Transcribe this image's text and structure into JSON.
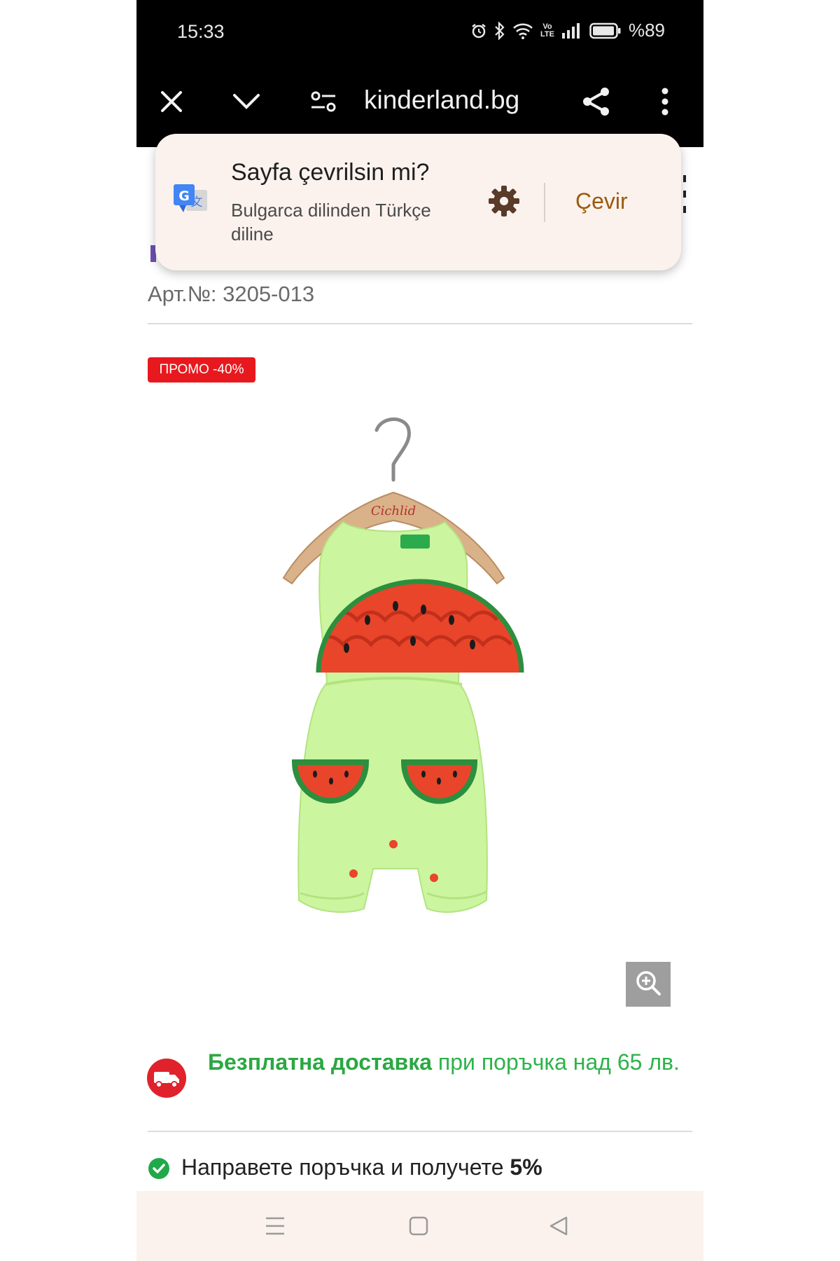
{
  "status_bar": {
    "time": "15:33",
    "battery": "%89"
  },
  "browser": {
    "url": "kinderland.bg",
    "icons": [
      "close-icon",
      "chevron-down-icon",
      "page-info-icon",
      "share-icon",
      "more-vert-icon"
    ]
  },
  "translate_popup": {
    "title": "Sayfa çevrilsin mi?",
    "subtitle": "Bulgarca dilinden Türkçe diline",
    "action_label": "Çevir",
    "icons": [
      "google-translate-icon",
      "gear-icon"
    ]
  },
  "product": {
    "article_number": "Арт.№: 3205-013",
    "promo_badge": "ПРОМО -40%",
    "image_logo_text": "Cichlid",
    "colors": {
      "promo": "#e8191e",
      "delivery_green": "#2db34a",
      "garment": "#ccf5a0"
    }
  },
  "delivery": {
    "bold": "Безплатна доставка",
    "text": " при поръчка над 65 лв."
  },
  "promo_line": {
    "text": "Направете поръчка и получете ",
    "bold": "5%"
  },
  "nav_bar": {
    "icons": [
      "recent-apps-icon",
      "home-icon",
      "back-icon"
    ]
  }
}
